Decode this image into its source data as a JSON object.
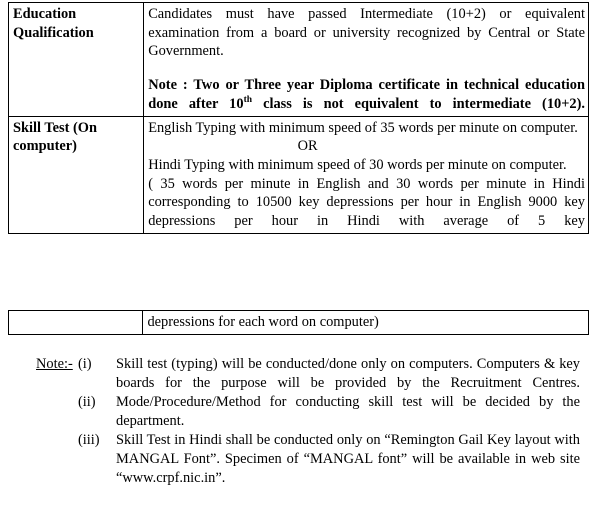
{
  "document": {
    "type": "recruitment-eligibility-table",
    "table_rows": [
      {
        "label": "Education Qualification",
        "label_line1": "Education",
        "label_line2": "Qualification",
        "paragraphs": [
          "Candidates must have passed Intermediate (10+2) or equivalent examination from a board or university recognized by Central or State Government.",
          "Note : Two or Three year Diploma certificate in technical education done after 10th class is not equivalent    to intermediate (10+2)."
        ],
        "note_parts": {
          "before_sup": "Note : Two or Three year Diploma certificate in technical education done after 10",
          "sup": "th",
          "after_sup": " class is not equivalent    to intermediate (10+2)."
        }
      },
      {
        "label": "Skill Test (On computer)",
        "label_line1": "Skill    Test    (On",
        "label_line2": "computer)",
        "lines": [
          "English Typing with minimum speed of 35 words per minute on computer.",
          "OR",
          "Hindi Typing with minimum speed of 30 words per minute on computer.",
          "( 35 words per minute in English and 30 words per minute in Hindi corresponding to 10500 key depressions per hour in English 9000 key depressions per hour in Hindi with average of 5 key"
        ]
      },
      {
        "label": "",
        "lines": [
          "depressions for each word on computer)"
        ]
      }
    ]
  },
  "notes": {
    "heading": "Note:-",
    "items": [
      {
        "numeral": "(i)",
        "text": "Skill test (typing) will be conducted/done only on computers. Computers & key boards for the purpose will be provided by the Recruitment Centres."
      },
      {
        "numeral": "(ii)",
        "text": "Mode/Procedure/Method for conducting skill test will be decided by the department."
      },
      {
        "numeral": "(iii)",
        "text": "Skill Test in Hindi shall be conducted only on “Remington Gail Key layout with MANGAL Font”. Specimen of “MANGAL font” will be available in  web site “www.crpf.nic.in”."
      }
    ]
  },
  "colors": {
    "text": "#000000",
    "border": "#000000",
    "background": "#ffffff"
  }
}
